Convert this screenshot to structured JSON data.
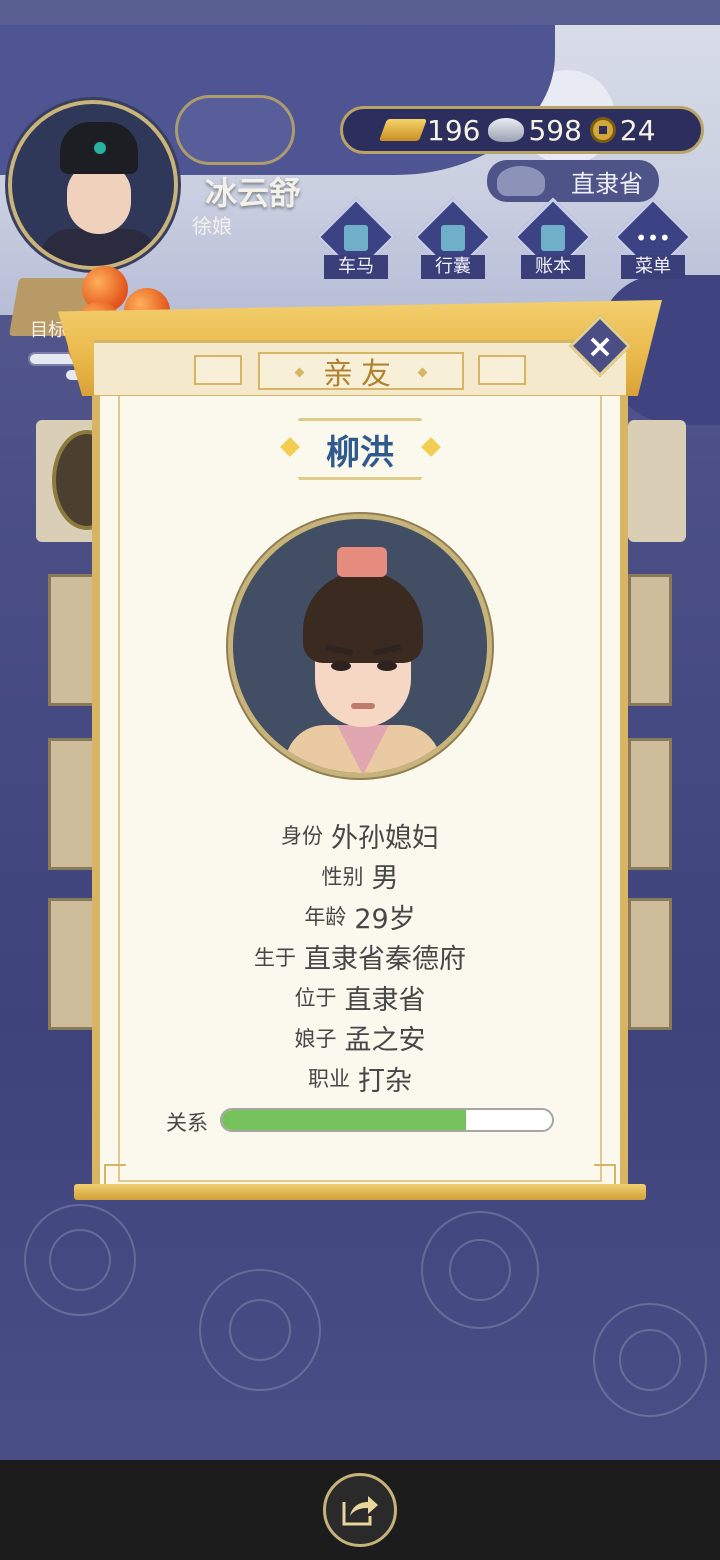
{
  "player": {
    "name": "冰云舒",
    "title": "徐娘"
  },
  "currency": {
    "gold": "196",
    "silver": "598",
    "copper": "24"
  },
  "location": "直隶省",
  "nav": [
    {
      "label": "车马",
      "icon": "carriage-icon"
    },
    {
      "label": "行囊",
      "icon": "bag-icon"
    },
    {
      "label": "账本",
      "icon": "ledger-icon"
    },
    {
      "label": "菜单",
      "icon": "menu-dots-icon"
    }
  ],
  "goal_label": "目标",
  "modal": {
    "title": "亲友",
    "npc_name": "柳洪",
    "info": [
      {
        "key": "身份",
        "value": "外孙媳妇"
      },
      {
        "key": "性别",
        "value": "男"
      },
      {
        "key": "年龄",
        "value": "29岁"
      },
      {
        "key": "生于",
        "value": "直隶省秦德府"
      },
      {
        "key": "位于",
        "value": "直隶省"
      },
      {
        "key": "娘子",
        "value": "孟之安"
      },
      {
        "key": "职业",
        "value": "打杂"
      }
    ],
    "relation_label": "关系",
    "relation_value": 0.74
  },
  "colors": {
    "accent_gold": "#d7b563",
    "name_blue": "#2e5a8e",
    "relation_green": "#77c15c",
    "background_indigo": "#4a4f86"
  }
}
